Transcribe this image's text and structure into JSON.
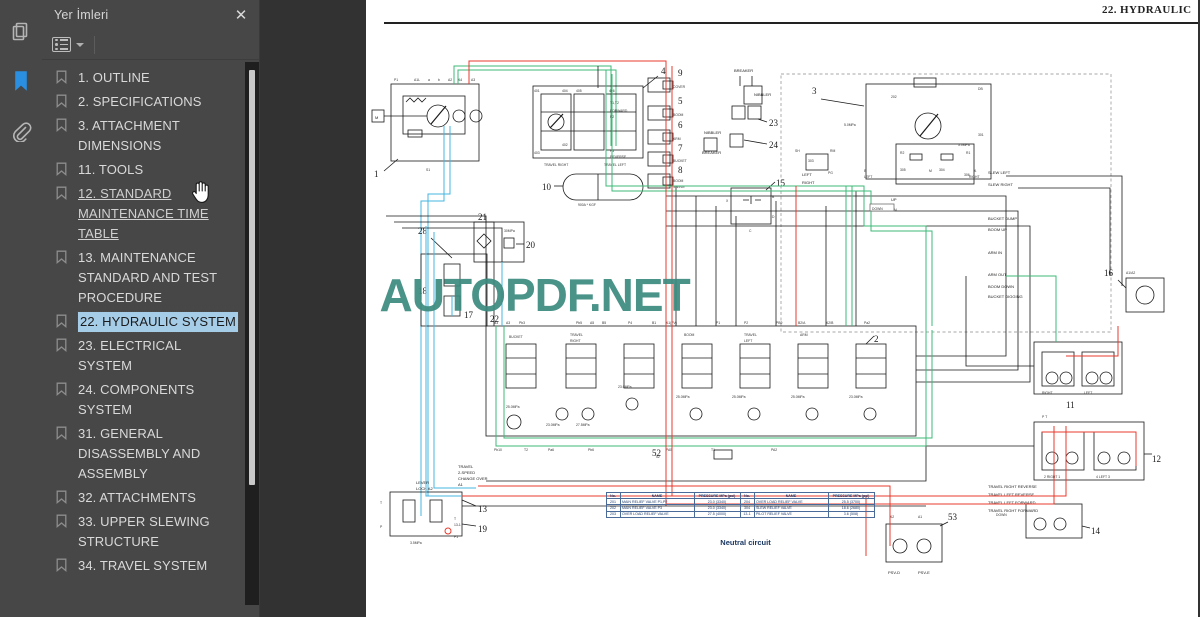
{
  "window": {
    "background_color": "#323232",
    "panel_color": "#474747"
  },
  "rail": {
    "items": [
      {
        "icon": "pages-thumbnail-icon",
        "name": "Sayfa Küçük Resimleri",
        "active": false
      },
      {
        "icon": "bookmark-icon",
        "name": "Yer İmleri",
        "active": true
      },
      {
        "icon": "attachment-paperclip-icon",
        "name": "Ekler",
        "active": false
      }
    ],
    "active_color": "#2a8fe0",
    "inactive_color": "#b5b5b5"
  },
  "panel": {
    "title": "Yer İmleri",
    "close_label": "✕",
    "toolbar": {
      "options_icon": "list-options-icon",
      "dropdown_icon": "chevron-down-icon"
    },
    "collapse_icon": "collapse-left-arrow-icon",
    "selected_index": 6,
    "selection_color": "#a6cde8",
    "items": [
      {
        "label": "1. OUTLINE",
        "state": "normal"
      },
      {
        "label": "2. SPECIFICATIONS",
        "state": "normal"
      },
      {
        "label": "3. ATTACHMENT DIMENSIONS",
        "state": "normal"
      },
      {
        "label": "11. TOOLS",
        "state": "normal"
      },
      {
        "label": "12. STANDARD MAINTENANCE TIME TABLE",
        "state": "visited"
      },
      {
        "label": "13. MAINTENANCE STANDARD AND TEST PROCEDURE",
        "state": "normal"
      },
      {
        "label": "22. HYDRAULIC SYSTEM",
        "state": "selected"
      },
      {
        "label": "23. ELECTRICAL SYSTEM",
        "state": "normal"
      },
      {
        "label": "24. COMPONENTS SYSTEM",
        "state": "normal"
      },
      {
        "label": "31. GENERAL DISASSEMBLY AND ASSEMBLY",
        "state": "normal"
      },
      {
        "label": "32. ATTACHMENTS",
        "state": "normal"
      },
      {
        "label": "33. UPPER SLEWING STRUCTURE",
        "state": "normal"
      },
      {
        "label": "34. TRAVEL SYSTEM",
        "state": "normal"
      }
    ]
  },
  "document": {
    "header_title": "22.  HYDRAULIC",
    "watermark": "AUTOPDF.NET",
    "watermark_color": "#3d8b80",
    "caption": "Neutral circuit",
    "table": {
      "headers": [
        "No.",
        "NAME",
        "PRESSURE MPa (psi)",
        "No.",
        "NAME",
        "PRESSURE MPa (psi)"
      ],
      "rows": [
        [
          "201",
          "MAIN RELIEF VALVE P1,P2",
          "23.0 (3340)",
          "204",
          "OVER LOAD RELIEF VALVE",
          "25.5 (3700)"
        ],
        [
          "202",
          "MAIN RELIEF VALVE P3",
          "23.0 (3340)",
          "304",
          "SLEW RELIEF VALVE",
          "18.6 (2680)"
        ],
        [
          "203",
          "OVER LOAD RELIEF VALVE",
          "27.5 (4000)",
          "13-1",
          "PILOT RELIEF VALVE",
          "3.6 (508)"
        ]
      ]
    },
    "diagram": {
      "title": "hydraulic-circuit-schematic",
      "item_numbers": [
        "1",
        "2",
        "3",
        "4",
        "5",
        "6",
        "7",
        "8",
        "9",
        "10",
        "11",
        "12",
        "13",
        "14",
        "15",
        "16",
        "17",
        "19",
        "20",
        "21",
        "22",
        "23",
        "24",
        "28",
        "52",
        "53",
        "19"
      ],
      "text_labels": [
        "TRAVEL RIGHT",
        "TRAVEL LEFT",
        "FORWARD",
        "REVERSE",
        "BREAKER",
        "NIBBLER",
        "COVER",
        "BOOM",
        "ARM",
        "BUCKET",
        "BOOM SWING",
        "SLEW LEFT",
        "SLEW RIGHT",
        "UP",
        "DOWN",
        "BUCKET DUMP",
        "BOOM UP",
        "ARM IN",
        "ARM OUT",
        "BOOM DOWN",
        "BUCKET DIGGING",
        "LEFT",
        "RIGHT",
        "LEVER LOCK  A2",
        "TRAVEL 2-SPEED CHANGE OVER  A1",
        "TRAVEL RIGHT REVERSE",
        "TRAVEL LEFT REVERSE",
        "TRAVEL LEFT FORWARD",
        "TRAVEL RIGHT FORWARD",
        "PSV-D",
        "PSV-E",
        "3.5MPa",
        "23.0MPa",
        "25.5MPa",
        "27.5MPa",
        "5.0MPa"
      ],
      "line_colors": {
        "black": "#1a1a1a",
        "green": "#3cb878",
        "cyan": "#46b4e0",
        "red": "#e8392c",
        "gray": "#6b6b6b"
      }
    }
  }
}
